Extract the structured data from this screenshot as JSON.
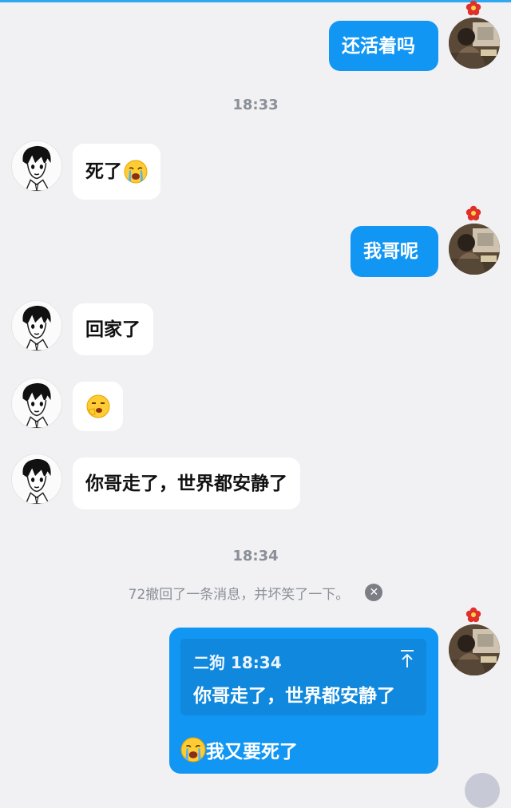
{
  "colors": {
    "accent": "#1296f3",
    "background": "#f1f1f3",
    "incoming_bubble": "#ffffff"
  },
  "messages": {
    "m1": {
      "sender": "self",
      "text": "还活着吗"
    },
    "t1": {
      "time": "18:33"
    },
    "m2": {
      "sender": "other",
      "text": "死了",
      "emoji": "loudly-crying-face"
    },
    "m3": {
      "sender": "self",
      "text": "我哥呢"
    },
    "m4": {
      "sender": "other",
      "text": "回家了"
    },
    "m5": {
      "sender": "other",
      "emoji": "yawning-face-sticker"
    },
    "m6": {
      "sender": "other",
      "text": "你哥走了，世界都安静了"
    },
    "t2": {
      "time": "18:34"
    },
    "recall": {
      "text": "72撤回了一条消息，并坏笑了一下。"
    },
    "m7": {
      "sender": "self",
      "quote": {
        "author": "二狗",
        "time": "18:34",
        "text": "你哥走了，世界都安静了"
      },
      "emoji": "loudly-crying-face",
      "text": "我又要死了"
    }
  },
  "icons": {
    "avatar_other": "anime-boy-avatar",
    "avatar_self": "photo-avatar",
    "badge": "red-flower-icon",
    "recall_close": "close-circle-icon",
    "quote_jump": "jump-to-message-icon"
  }
}
